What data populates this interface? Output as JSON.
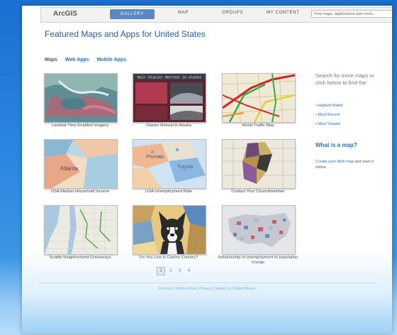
{
  "rating_stars": "★★★☆☆",
  "topbar": {
    "logo": "ArcGIS",
    "tabs": {
      "gallery": "GALLERY",
      "map": "MAP",
      "groups": "GROUPS",
      "my_content": "MY CONTENT"
    },
    "search_placeholder": "Find maps, applications and more...",
    "search_icon": "search-icon"
  },
  "page_title": "Featured Maps and Apps for United States",
  "subtabs": [
    "Maps",
    "Web Apps",
    "Mobile Apps"
  ],
  "gallery": [
    {
      "caption": "Landsat Time Enabled Imagery"
    },
    {
      "caption": "Glacier Retreat in Alaska"
    },
    {
      "caption": "World Traffic Map"
    },
    {
      "caption": "USA Median Household Income"
    },
    {
      "caption": "USA Unemployment Rate"
    },
    {
      "caption": "Contact Your Councilmember"
    },
    {
      "caption": "Seattle Neighborhood Greenways"
    },
    {
      "caption": "Do You Live in Canine Country?"
    },
    {
      "caption": "Relationship of unemployment to population change"
    }
  ],
  "sidebar": {
    "heading": "Search for more maps or click below to find the:",
    "links": [
      "Highest Rated",
      "Most Recent",
      "Most Viewed"
    ],
    "what_is_map": "What is a map?",
    "create_link": "Create your Web map",
    "create_rest": " and save it online."
  },
  "pagination": {
    "pages": [
      "1",
      "2",
      "3",
      "4"
    ],
    "current": "1"
  },
  "footer": "Esri.com  |  Terms of Use  |  Privacy  |  Contact Us  |  Report Abuse",
  "thumb_texts": {
    "glacier_banner": "Muir Glacier Retreat in Alaska",
    "atlanta": "Atlanta",
    "phoenix": "Phoenix",
    "tucson": "Tucson"
  },
  "colors": {
    "accent": "#2a6fc0",
    "nav_active": "#5a88c0",
    "background": "#1b6fd0"
  }
}
